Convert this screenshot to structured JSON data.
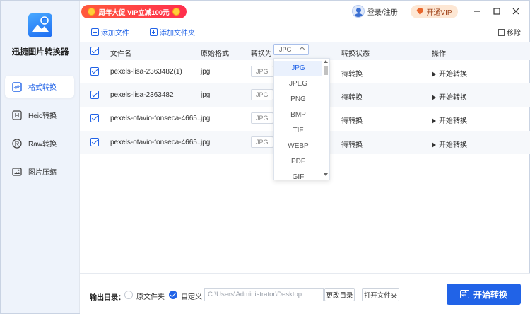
{
  "app": {
    "title": "迅捷图片转换器"
  },
  "promo": {
    "text": "周年大促 VIP立减100元"
  },
  "header": {
    "login": "登录/注册",
    "vip": "开通VIP"
  },
  "toolbar": {
    "add_file": "添加文件",
    "add_folder": "添加文件夹",
    "remove": "移除"
  },
  "sidebar": {
    "items": [
      {
        "label": "格式转换",
        "icon": "format-convert-icon",
        "active": true
      },
      {
        "label": "Heic转换",
        "icon": "heic-icon"
      },
      {
        "label": "Raw转换",
        "icon": "raw-icon"
      },
      {
        "label": "图片压缩",
        "icon": "image-compress-icon"
      }
    ]
  },
  "table": {
    "headers": {
      "name": "文件名",
      "format": "原始格式",
      "convert_to": "转换为",
      "status": "转换状态",
      "action": "操作"
    },
    "convert_to_value": "JPG",
    "rows": [
      {
        "name": "pexels-lisa-2363482(1)",
        "format": "jpg",
        "target": "JPG",
        "status": "待转换",
        "action": "开始转换"
      },
      {
        "name": "pexels-lisa-2363482",
        "format": "jpg",
        "target": "JPG",
        "status": "待转换",
        "action": "开始转换"
      },
      {
        "name": "pexels-otavio-fonseca-4665...",
        "format": "jpg",
        "target": "JPG",
        "status": "待转换",
        "action": "开始转换"
      },
      {
        "name": "pexels-otavio-fonseca-4665...",
        "format": "jpg",
        "target": "JPG",
        "status": "待转换",
        "action": "开始转换"
      }
    ]
  },
  "dropdown": {
    "options": [
      "JPG",
      "JPEG",
      "PNG",
      "BMP",
      "TIF",
      "WEBP",
      "PDF",
      "GIF"
    ],
    "selected": "JPG"
  },
  "output": {
    "label": "输出目录：",
    "option_original": "原文件夹",
    "option_custom": "自定义",
    "path": "C:\\Users\\Administrator\\Desktop",
    "change_dir": "更改目录",
    "open_folder": "打开文件夹",
    "start": "开始转换"
  },
  "colors": {
    "accent": "#2163e7",
    "promo": "#ff3a4a",
    "vip_bg": "#fde7d4"
  }
}
